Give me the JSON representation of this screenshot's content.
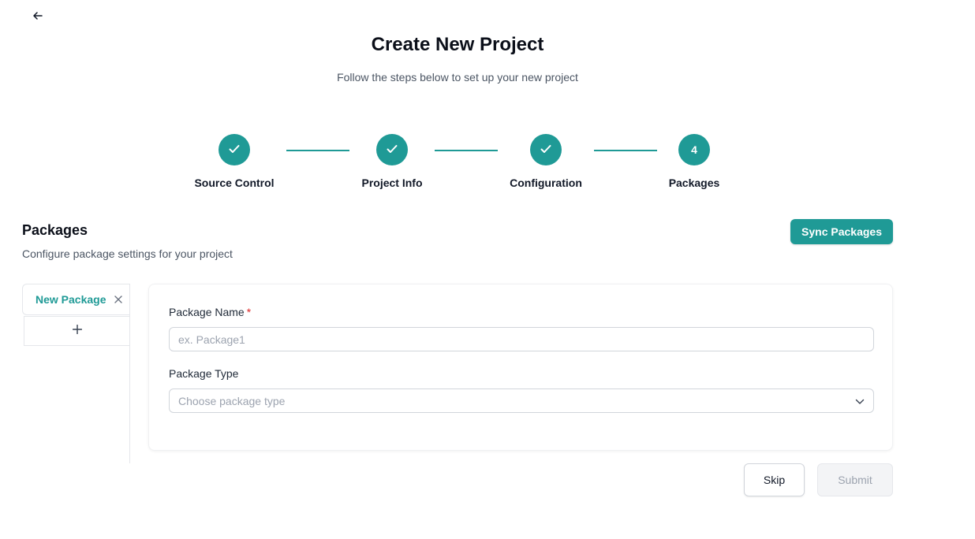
{
  "header": {
    "back_icon": "arrow-left-icon",
    "title": "Create New Project",
    "subtitle": "Follow the steps below to set up your new project"
  },
  "stepper": {
    "accent_color": "#1f9a96",
    "steps": [
      {
        "label": "Source Control",
        "status": "completed",
        "icon": "check-icon"
      },
      {
        "label": "Project Info",
        "status": "completed",
        "icon": "check-icon"
      },
      {
        "label": "Configuration",
        "status": "completed",
        "icon": "check-icon"
      },
      {
        "label": "Packages",
        "status": "current",
        "number": "4"
      }
    ]
  },
  "section": {
    "title": "Packages",
    "subtitle": "Configure package settings for your project",
    "sync_button": "Sync Packages"
  },
  "tabs": {
    "items": [
      {
        "label": "New Package",
        "close_icon": "close-icon"
      }
    ],
    "add_icon": "plus-icon"
  },
  "form": {
    "name_label": "Package Name",
    "required_mark": "*",
    "name_value": "",
    "name_placeholder": "ex. Package1",
    "type_label": "Package Type",
    "type_placeholder": "Choose package type",
    "type_icon": "chevron-down-icon"
  },
  "actions": {
    "skip": "Skip",
    "submit": "Submit"
  }
}
